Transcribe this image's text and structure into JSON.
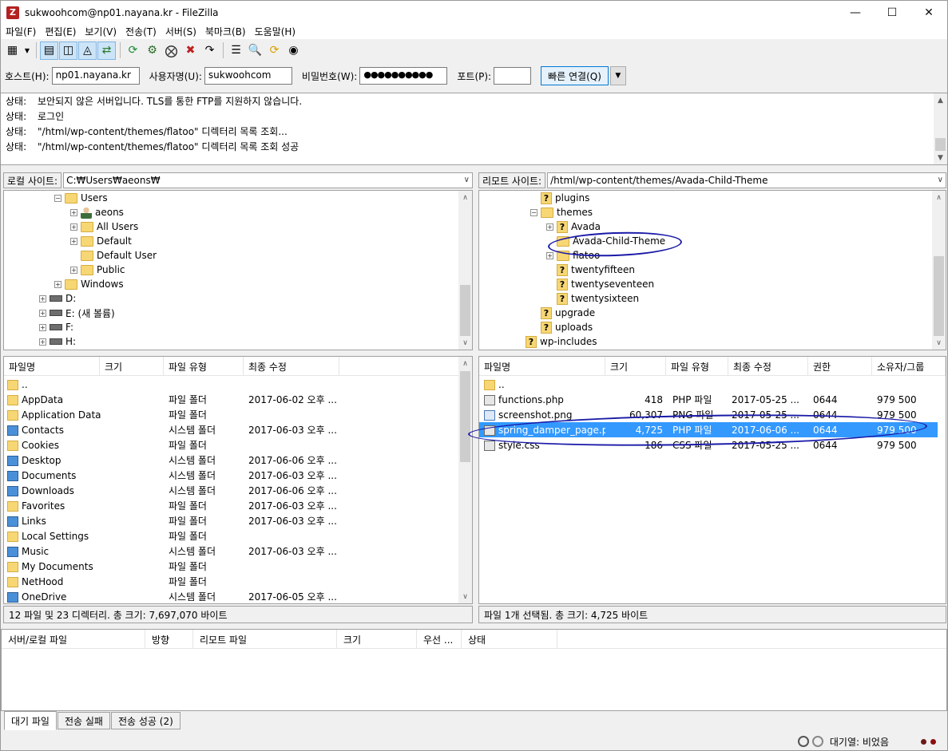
{
  "window": {
    "title": "sukwoohcom@np01.nayana.kr - FileZilla",
    "app_icon_letter": "Z"
  },
  "menu": [
    "파일(F)",
    "편집(E)",
    "보기(V)",
    "전송(T)",
    "서버(S)",
    "북마크(B)",
    "도움말(H)"
  ],
  "quickconnect": {
    "host_label": "호스트(H):",
    "host_value": "np01.nayana.kr",
    "user_label": "사용자명(U):",
    "user_value": "sukwoohcom",
    "pass_label": "비밀번호(W):",
    "pass_value": "●●●●●●●●●●",
    "port_label": "포트(P):",
    "port_value": "",
    "connect_label": "빠른 연결(Q)"
  },
  "log": [
    {
      "k": "상태:",
      "v": "보안되지 않은 서버입니다. TLS를 통한 FTP를 지원하지 않습니다."
    },
    {
      "k": "상태:",
      "v": "로그인"
    },
    {
      "k": "상태:",
      "v": "\"/html/wp-content/themes/flatoo\" 디렉터리 목록 조회..."
    },
    {
      "k": "상태:",
      "v": "\"/html/wp-content/themes/flatoo\" 디렉터리 목록 조회 성공"
    }
  ],
  "local": {
    "site_label": "로컬 사이트:",
    "path": "C:₩Users₩aeons₩",
    "tree": [
      {
        "label": "Users",
        "exp": "−",
        "icon": "folder",
        "indent": 66
      },
      {
        "label": "aeons",
        "exp": "+",
        "icon": "user",
        "indent": 86
      },
      {
        "label": "All Users",
        "exp": "+",
        "icon": "folder",
        "indent": 86
      },
      {
        "label": "Default",
        "exp": "+",
        "icon": "folder",
        "indent": 86
      },
      {
        "label": "Default User",
        "exp": "",
        "icon": "folder",
        "indent": 86
      },
      {
        "label": "Public",
        "exp": "+",
        "icon": "folder",
        "indent": 86
      },
      {
        "label": "Windows",
        "exp": "+",
        "icon": "folder",
        "indent": 66
      },
      {
        "label": "D:",
        "exp": "+",
        "icon": "drive",
        "indent": 47
      },
      {
        "label": "E: (새 볼륨)",
        "exp": "+",
        "icon": "drive",
        "indent": 47
      },
      {
        "label": "F:",
        "exp": "+",
        "icon": "drive",
        "indent": 47
      },
      {
        "label": "H:",
        "exp": "+",
        "icon": "drive",
        "indent": 47
      }
    ],
    "columns": [
      "파일명",
      "크기",
      "파일 유형",
      "최종 수정"
    ],
    "files": [
      {
        "name": "..",
        "size": "",
        "type": "",
        "modified": "",
        "icon": "folder"
      },
      {
        "name": "AppData",
        "size": "",
        "type": "파일 폴더",
        "modified": "2017-06-02 오후 ...",
        "icon": "folder"
      },
      {
        "name": "Application Data",
        "size": "",
        "type": "파일 폴더",
        "modified": "",
        "icon": "folder"
      },
      {
        "name": "Contacts",
        "size": "",
        "type": "시스템 폴더",
        "modified": "2017-06-03 오후 ...",
        "icon": "sys"
      },
      {
        "name": "Cookies",
        "size": "",
        "type": "파일 폴더",
        "modified": "",
        "icon": "folder"
      },
      {
        "name": "Desktop",
        "size": "",
        "type": "시스템 폴더",
        "modified": "2017-06-06 오후 ...",
        "icon": "sys"
      },
      {
        "name": "Documents",
        "size": "",
        "type": "시스템 폴더",
        "modified": "2017-06-03 오후 ...",
        "icon": "sys"
      },
      {
        "name": "Downloads",
        "size": "",
        "type": "시스템 폴더",
        "modified": "2017-06-06 오후 ...",
        "icon": "sys"
      },
      {
        "name": "Favorites",
        "size": "",
        "type": "파일 폴더",
        "modified": "2017-06-03 오후 ...",
        "icon": "folder"
      },
      {
        "name": "Links",
        "size": "",
        "type": "파일 폴더",
        "modified": "2017-06-03 오후 ...",
        "icon": "sys"
      },
      {
        "name": "Local Settings",
        "size": "",
        "type": "파일 폴더",
        "modified": "",
        "icon": "folder"
      },
      {
        "name": "Music",
        "size": "",
        "type": "시스템 폴더",
        "modified": "2017-06-03 오후 ...",
        "icon": "sys"
      },
      {
        "name": "My Documents",
        "size": "",
        "type": "파일 폴더",
        "modified": "",
        "icon": "folder"
      },
      {
        "name": "NetHood",
        "size": "",
        "type": "파일 폴더",
        "modified": "",
        "icon": "folder"
      },
      {
        "name": "OneDrive",
        "size": "",
        "type": "시스템 폴더",
        "modified": "2017-06-05 오후 ...",
        "icon": "sys"
      }
    ],
    "status": "12 파일 및 23 디렉터리. 총 크기: 7,697,070 바이트"
  },
  "remote": {
    "site_label": "리모트 사이트:",
    "path": "/html/wp-content/themes/Avada-Child-Theme",
    "tree": [
      {
        "label": "plugins",
        "exp": "",
        "icon": "q",
        "indent": 662
      },
      {
        "label": "themes",
        "exp": "−",
        "icon": "folder",
        "indent": 662
      },
      {
        "label": "Avada",
        "exp": "+",
        "icon": "q",
        "indent": 682
      },
      {
        "label": "Avada-Child-Theme",
        "exp": "",
        "icon": "folder",
        "indent": 682
      },
      {
        "label": "flatoo",
        "exp": "+",
        "icon": "folder",
        "indent": 682
      },
      {
        "label": "twentyfifteen",
        "exp": "",
        "icon": "q",
        "indent": 682
      },
      {
        "label": "twentyseventeen",
        "exp": "",
        "icon": "q",
        "indent": 682
      },
      {
        "label": "twentysixteen",
        "exp": "",
        "icon": "q",
        "indent": 682
      },
      {
        "label": "upgrade",
        "exp": "",
        "icon": "q",
        "indent": 662
      },
      {
        "label": "uploads",
        "exp": "",
        "icon": "q",
        "indent": 662
      },
      {
        "label": "wp-includes",
        "exp": "",
        "icon": "q",
        "indent": 643
      }
    ],
    "columns": [
      "파일명",
      "크기",
      "파일 유형",
      "최종 수정",
      "권한",
      "소유자/그룹"
    ],
    "files": [
      {
        "name": "..",
        "size": "",
        "type": "",
        "modified": "",
        "perm": "",
        "owner": "",
        "icon": "folder"
      },
      {
        "name": "functions.php",
        "size": "418",
        "type": "PHP 파일",
        "modified": "2017-05-25 ...",
        "perm": "0644",
        "owner": "979 500",
        "icon": "php"
      },
      {
        "name": "screenshot.png",
        "size": "60,307",
        "type": "PNG 파일",
        "modified": "2017-05-25 ...",
        "perm": "0644",
        "owner": "979 500",
        "icon": "png"
      },
      {
        "name": "spring_damper_page.php",
        "size": "4,725",
        "type": "PHP 파일",
        "modified": "2017-06-06 ...",
        "perm": "0644",
        "owner": "979 500",
        "icon": "php"
      },
      {
        "name": "style.css",
        "size": "186",
        "type": "CSS 파일",
        "modified": "2017-05-25 ...",
        "perm": "0644",
        "owner": "979 500",
        "icon": "css"
      }
    ],
    "selected_file": "spring_damper_page.php",
    "status": "파일 1개 선택됨. 총 크기: 4,725 바이트"
  },
  "queue": {
    "columns": [
      "서버/로컬 파일",
      "방향",
      "리모트 파일",
      "크기",
      "우선 ...",
      "상태"
    ],
    "tabs": [
      "대기 파일",
      "전송 실패",
      "전송 성공 (2)"
    ]
  },
  "footer": {
    "queue_status": "대기열: 비었음"
  },
  "colors": {
    "selection": "#3399ff",
    "annotation": "#1a1aa8",
    "folder": "#f7d774"
  }
}
